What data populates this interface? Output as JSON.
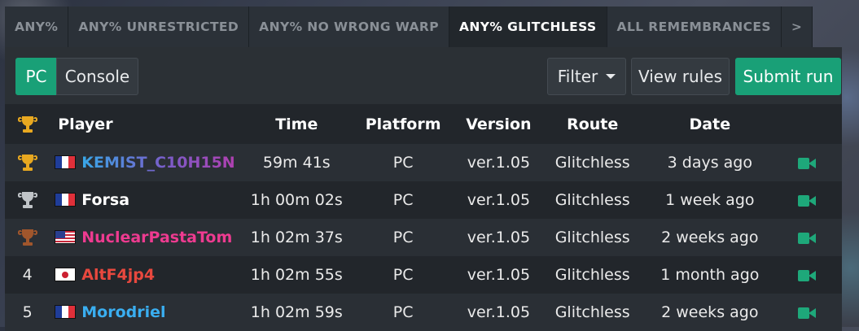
{
  "tabs": [
    {
      "label": "ANY%"
    },
    {
      "label": "ANY% UNRESTRICTED"
    },
    {
      "label": "ANY% NO WRONG WARP"
    },
    {
      "label": "ANY% GLITCHLESS",
      "active": true
    },
    {
      "label": "ALL REMEMBRANCES"
    },
    {
      "label": ">"
    }
  ],
  "toolbar": {
    "platform_options": [
      "PC",
      "Console"
    ],
    "selected_platform": "PC",
    "filter_label": "Filter",
    "view_rules_label": "View rules",
    "submit_label": "Submit run"
  },
  "table": {
    "columns": {
      "rank_icon": "trophy-icon",
      "player": "Player",
      "time": "Time",
      "platform": "Platform",
      "version": "Version",
      "route": "Route",
      "date": "Date"
    },
    "rows": [
      {
        "rank": "1",
        "rank_icon": "gold-trophy-icon",
        "flag": "france-flag-icon",
        "player": "KEMIST_C10H15N",
        "time": "59m 41s",
        "platform": "PC",
        "version": "ver.1.05",
        "route": "Glitchless",
        "date": "3 days ago",
        "video_icon": "video-camera-icon"
      },
      {
        "rank": "2",
        "rank_icon": "silver-trophy-icon",
        "flag": "france-flag-icon",
        "player": "Forsa",
        "time": "1h 00m 02s",
        "platform": "PC",
        "version": "ver.1.05",
        "route": "Glitchless",
        "date": "1 week ago",
        "video_icon": "video-camera-icon"
      },
      {
        "rank": "3",
        "rank_icon": "bronze-trophy-icon",
        "flag": "usa-flag-icon",
        "player": "NuclearPastaTom",
        "time": "1h 02m 37s",
        "platform": "PC",
        "version": "ver.1.05",
        "route": "Glitchless",
        "date": "2 weeks ago",
        "video_icon": "video-camera-icon"
      },
      {
        "rank": "4",
        "flag": "japan-flag-icon",
        "player": "AltF4jp4",
        "time": "1h 02m 55s",
        "platform": "PC",
        "version": "ver.1.05",
        "route": "Glitchless",
        "date": "1 month ago",
        "video_icon": "video-camera-icon"
      },
      {
        "rank": "5",
        "flag": "france-flag-icon",
        "player": "Morodriel",
        "time": "1h 02m 59s",
        "platform": "PC",
        "version": "ver.1.05",
        "route": "Glitchless",
        "date": "2 weeks ago",
        "video_icon": "video-camera-icon"
      }
    ]
  },
  "colors": {
    "accent": "#19a077",
    "gold": "#e8a820",
    "silver": "#c0c4c8",
    "bronze": "#a0562c"
  }
}
